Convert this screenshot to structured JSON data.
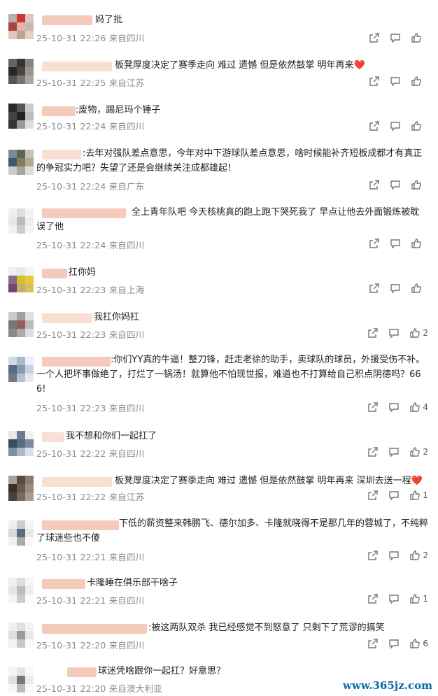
{
  "comments": [
    {
      "text": "妈了批",
      "time": "25-10-31 22:26 来自四川",
      "likes": ""
    },
    {
      "text": "板凳厚度决定了赛季走向 难过 遗憾 但是依然鼓掌 明年再来❤️",
      "time": "25-10-31 22:25 来自江苏",
      "likes": ""
    },
    {
      "text": ":废物，踢尼玛个锤子",
      "time": "25-10-31 22:24 来自四川",
      "likes": ""
    },
    {
      "text": ":去年对强队差点意思，今年对中下游球队差点意思，啥时候能补齐短板成都才有真正的争冠实力吧？失望了还是会继续关注成都雄起！",
      "time": "25-10-31 22:24 来自广东",
      "likes": ""
    },
    {
      "text": "全上青年队吧 今天核桃真的跑上跑下哭死我了 早点让他去外面锻炼被耽误了他",
      "time": "25-10-31 22:24 来自四川",
      "likes": ""
    },
    {
      "text": "扛你妈",
      "time": "25-10-31 22:23 来自上海",
      "likes": ""
    },
    {
      "text": "我扛你妈扛",
      "time": "25-10-31 22:23 来自四川",
      "likes": "2"
    },
    {
      "text": ":你们YY真的牛逼！整刀锋，赶走老徐的助手，卖球队的球员，外援受伤不补。一个人把坏事做绝了，打烂了一锅汤！就算他不怕现世报，难道也不打算给自己积点阴德吗？666!",
      "time": "25-10-31 22:23 来自四川",
      "likes": "4"
    },
    {
      "text": "我不想和你们一起扛了",
      "time": "25-10-31 22:22 来自四川",
      "likes": "2"
    },
    {
      "text": "板凳厚度决定了赛季走向 难过 遗憾 但是依然鼓掌 明年再来 深圳去送一程❤️",
      "time": "25-10-31 22:22 来自江苏",
      "likes": "1"
    },
    {
      "text": "下低的薪资整来韩鹏飞、德尔加多、卡隆就晓得不是那几年的蓉城了，不纯粹了球迷些也不傻",
      "time": "25-10-31 22:21 来自四川",
      "likes": "2"
    },
    {
      "text": "卡隆睡在俱乐部干啥子",
      "time": "25-10-31 22:21 来自四川",
      "likes": "1"
    },
    {
      "text": ":被这两队双杀 我已经感觉不到怒意了 只剩下了荒谬的搞笑",
      "time": "25-10-31 22:20 来自四川",
      "likes": "6"
    },
    {
      "text": "球迷凭啥跟你一起扛？好意思？",
      "time": "25-10-31 22:20 来自澳大利亚",
      "likes": ""
    }
  ],
  "icons": {
    "share": "share-icon",
    "comment": "comment-icon",
    "like": "thumbs-up-icon"
  },
  "watermark": "www.365jz.com"
}
